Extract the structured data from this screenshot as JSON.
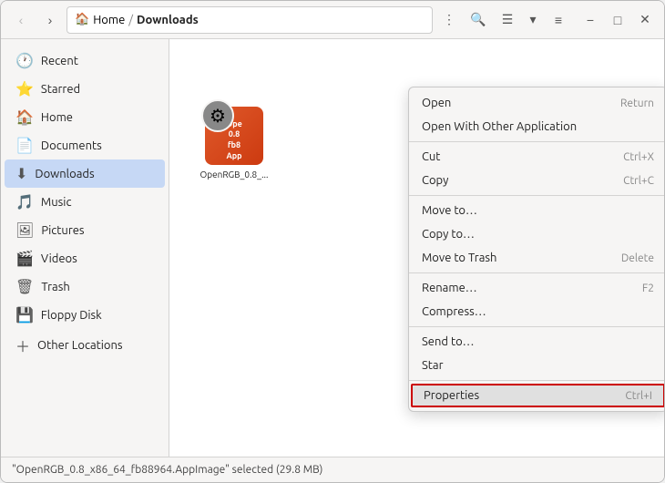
{
  "titlebar": {
    "breadcrumb_home": "Home",
    "breadcrumb_sep": "/",
    "breadcrumb_current": "Downloads",
    "more_options_label": "⋮",
    "search_label": "🔍"
  },
  "sidebar": {
    "items": [
      {
        "id": "recent",
        "icon": "🕐",
        "label": "Recent",
        "active": false
      },
      {
        "id": "starred",
        "icon": "⭐",
        "label": "Starred",
        "active": false
      },
      {
        "id": "home",
        "icon": "🏠",
        "label": "Home",
        "active": false
      },
      {
        "id": "documents",
        "icon": "📄",
        "label": "Documents",
        "active": false
      },
      {
        "id": "downloads",
        "icon": "⬇️",
        "label": "Downloads",
        "active": true
      },
      {
        "id": "music",
        "icon": "🎵",
        "label": "Music",
        "active": false
      },
      {
        "id": "pictures",
        "icon": "🖼️",
        "label": "Pictures",
        "active": false
      },
      {
        "id": "videos",
        "icon": "🎬",
        "label": "Videos",
        "active": false
      },
      {
        "id": "trash",
        "icon": "🗑️",
        "label": "Trash",
        "active": false
      },
      {
        "id": "floppy",
        "icon": "💾",
        "label": "Floppy Disk",
        "active": false
      },
      {
        "id": "other",
        "icon": "➕",
        "label": "Other Locations",
        "active": false
      }
    ]
  },
  "file": {
    "name": "OpenRGB_0.8_x86_64_fb88964.AppImage",
    "name_short": "Ope\n0.8\nfb8\nApp",
    "gear_icon": "⚙️"
  },
  "context_menu": {
    "items": [
      {
        "id": "open",
        "label": "Open",
        "shortcut": "Return"
      },
      {
        "id": "open-with",
        "label": "Open With Other Application",
        "shortcut": ""
      },
      {
        "id": "sep1",
        "type": "separator"
      },
      {
        "id": "cut",
        "label": "Cut",
        "shortcut": "Ctrl+X"
      },
      {
        "id": "copy",
        "label": "Copy",
        "shortcut": "Ctrl+C"
      },
      {
        "id": "sep2",
        "type": "separator"
      },
      {
        "id": "move-to",
        "label": "Move to…",
        "shortcut": ""
      },
      {
        "id": "copy-to",
        "label": "Copy to…",
        "shortcut": ""
      },
      {
        "id": "move-trash",
        "label": "Move to Trash",
        "shortcut": "Delete"
      },
      {
        "id": "sep3",
        "type": "separator"
      },
      {
        "id": "rename",
        "label": "Rename…",
        "shortcut": "F2"
      },
      {
        "id": "compress",
        "label": "Compress…",
        "shortcut": ""
      },
      {
        "id": "sep4",
        "type": "separator"
      },
      {
        "id": "send-to",
        "label": "Send to…",
        "shortcut": ""
      },
      {
        "id": "star",
        "label": "Star",
        "shortcut": ""
      },
      {
        "id": "sep5",
        "type": "separator"
      },
      {
        "id": "properties",
        "label": "Properties",
        "shortcut": "Ctrl+I",
        "highlighted": true
      }
    ]
  },
  "statusbar": {
    "text": "\"OpenRGB_0.8_x86_64_fb88964.AppImage\" selected (29.8 MB)"
  }
}
